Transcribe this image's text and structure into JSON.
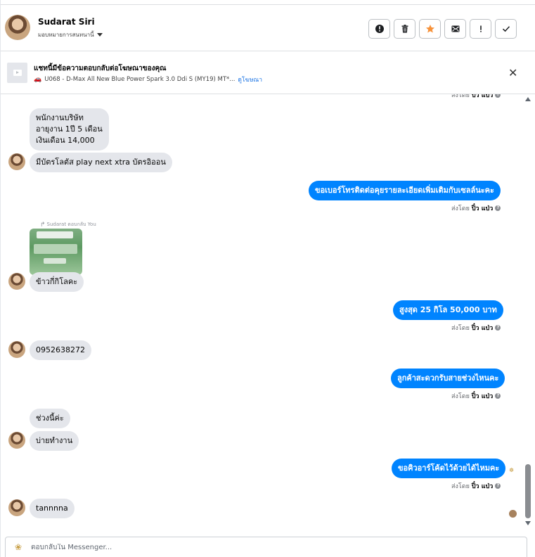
{
  "header": {
    "contact_name": "Sudarat Siri",
    "assign_label": "มอบหมายการสนทนานี้",
    "actions": [
      {
        "name": "spam",
        "icon": "alert-circle-icon"
      },
      {
        "name": "delete",
        "icon": "trash-icon"
      },
      {
        "name": "star",
        "icon": "star-icon",
        "color": "#f7923a"
      },
      {
        "name": "mark-unread",
        "icon": "envelope-icon"
      },
      {
        "name": "follow-up",
        "icon": "exclamation-icon"
      },
      {
        "name": "done",
        "icon": "check-icon"
      }
    ]
  },
  "ad": {
    "title": "แชทนี้มีข้อความตอบกลับต่อโฆษณาของคุณ",
    "description": "U068 - D-Max All New Blue Power Spark 3.0 Ddi S (MY19) MT*...",
    "link": "ดูโฆษณา"
  },
  "messages": {
    "m1_line1": "พนักงานบริษัท",
    "m1_line2": "อายุงาน 1ปี 5 เดือน",
    "m1_line3": "เงินเดือน 14,000",
    "m2": "มีบัตรโลตัส play next xtra บัตรอิออน",
    "m3": "ขอเบอร์โทรติดต่อคุยรายละเอียดเพิ่มเติมกับเซลล์นะคะ",
    "reply_note": "Sudarat ตอบกลับ You",
    "m4": "ข้าวกี่กิโลคะ",
    "m5": "สูงสุด   25 กิโล  50,000  บาท",
    "m6": "0952638272",
    "m7": "ลูกค้าสะดวกรับสายช่วงไหนคะ",
    "m8": "ช่วงนี้ค่ะ",
    "m9": "บ่ายทำงาน",
    "m10": "ขอคิวอาร์โค้ดไว้ด้วยได้ไหมคะ",
    "m11": "tannnna"
  },
  "sent_by": {
    "prefix": "ส่งโดย",
    "agent": "ปิ๋ว แป่ว"
  },
  "composer": {
    "placeholder": "ตอบกลับใน Messenger..."
  }
}
